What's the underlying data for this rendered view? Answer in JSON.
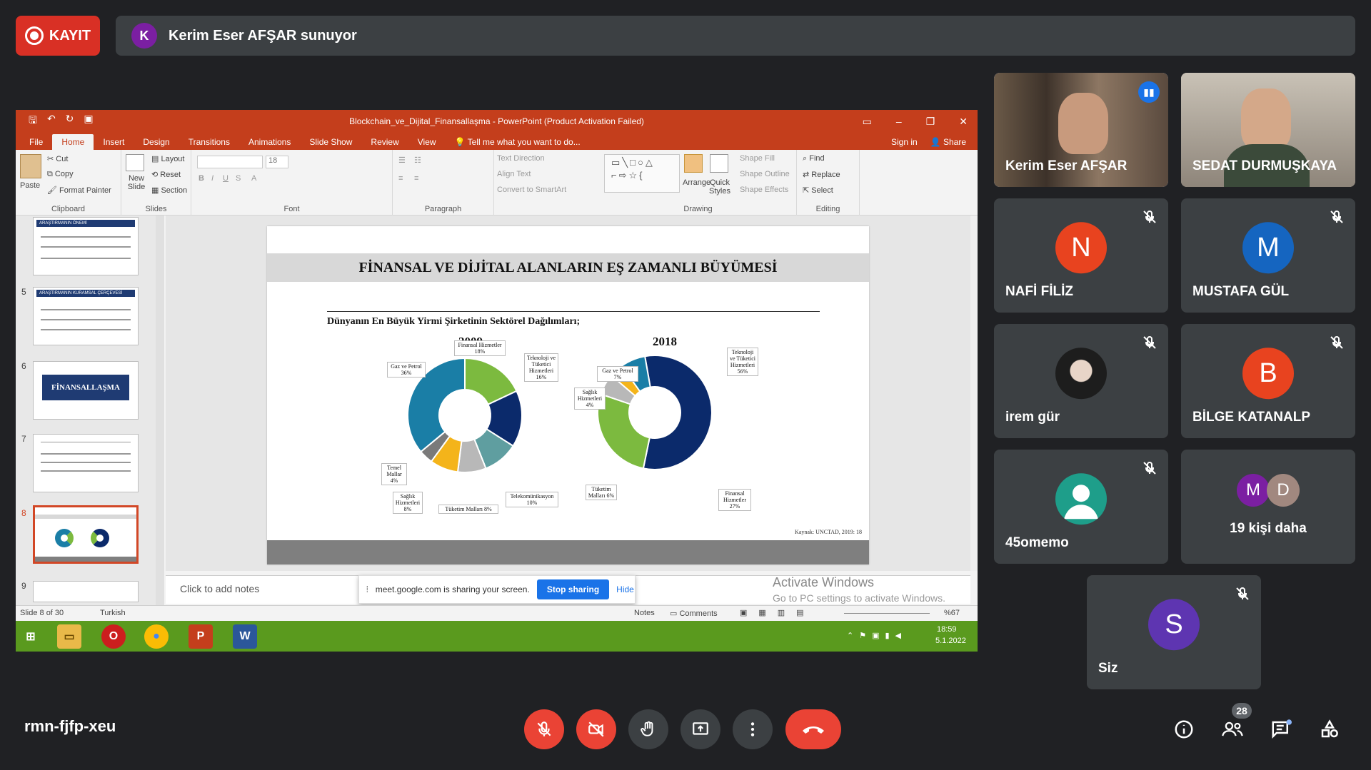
{
  "recording": {
    "label": "KAYIT"
  },
  "presenter": {
    "initial": "K",
    "text": "Kerim Eser AFŞAR sunuyor"
  },
  "ppt": {
    "title": "Blockchain_ve_Dijital_Finansallaşma - PowerPoint (Product Activation Failed)",
    "tabs": [
      "File",
      "Home",
      "Insert",
      "Design",
      "Transitions",
      "Animations",
      "Slide Show",
      "Review",
      "View"
    ],
    "tellme": "Tell me what you want to do...",
    "signin": "Sign in",
    "share": "Share",
    "ribbon": {
      "clipboard": {
        "label": "Clipboard",
        "paste": "Paste",
        "cut": "Cut",
        "copy": "Copy",
        "format_painter": "Format Painter"
      },
      "slides": {
        "label": "Slides",
        "new_slide": "New Slide",
        "layout": "Layout",
        "reset": "Reset",
        "section": "Section"
      },
      "font": {
        "label": "Font",
        "size": "18"
      },
      "paragraph": {
        "label": "Paragraph",
        "text_direction": "Text Direction",
        "align_text": "Align Text",
        "convert": "Convert to SmartArt"
      },
      "drawing": {
        "label": "Drawing",
        "arrange": "Arrange",
        "quick_styles": "Quick Styles",
        "shape_fill": "Shape Fill",
        "shape_outline": "Shape Outline",
        "shape_effects": "Shape Effects"
      },
      "editing": {
        "label": "Editing",
        "find": "Find",
        "replace": "Replace",
        "select": "Select"
      }
    },
    "thumbnails": [
      {
        "num": "",
        "title": "ARAŞTIRMANIN ÖNEMİ"
      },
      {
        "num": "5",
        "title": "ARAŞTIRMANIN KURAMSAL ÇERÇEVESİ"
      },
      {
        "num": "6",
        "title": "FİNANSALLAŞMA"
      },
      {
        "num": "7",
        "title": ""
      },
      {
        "num": "8",
        "title": ""
      },
      {
        "num": "9",
        "title": ""
      }
    ],
    "notes_placeholder": "Click to add notes",
    "status": {
      "slide": "Slide 8 of 30",
      "language": "Turkish",
      "notes": "Notes",
      "comments": "Comments",
      "zoom": "%67"
    },
    "taskbar": {
      "time": "18:59",
      "date": "5.1.2022"
    }
  },
  "slide": {
    "title": "FİNANSAL VE DİJİTAL ALANLARIN EŞ ZAMANLI BÜYÜMESİ",
    "subtitle": "Dünyanın En Büyük Yirmi Şirketinin Sektörel Dağılımları;",
    "source": "Kaynak: UNCTAD, 2019: 18"
  },
  "chart_data": [
    {
      "type": "pie",
      "title": "2009",
      "categories": [
        "Finansal Hizmetler",
        "Teknoloji ve Tüketici Hizmetleri",
        "Telekomünikasyon",
        "Tüketim Malları",
        "Sağlık Hizmetleri",
        "Temel Mallar",
        "Gaz ve Petrol"
      ],
      "labels": [
        "Finansal Hizmetler 18%",
        "Teknoloji ve Tüketici Hizmetleri 16%",
        "Telekomünikasyon 10%",
        "Tüketim Malları 8%",
        "Sağlık Hizmetleri 8%",
        "Temel Mallar 4%",
        "Gaz ve Petrol 36%"
      ],
      "values": [
        18,
        16,
        10,
        8,
        8,
        4,
        36
      ],
      "colors": [
        "#7cba3f",
        "#0b2a6b",
        "#5f9ea0",
        "#b8b8b8",
        "#f4b41a",
        "#7a7a7a",
        "#1a7ea6"
      ]
    },
    {
      "type": "pie",
      "title": "2018",
      "categories": [
        "Teknoloji ve Tüketici Hizmetleri",
        "Finansal Hizmetler",
        "Tüketim Malları",
        "Sağlık Hizmetleri",
        "Gaz ve Petrol"
      ],
      "labels": [
        "Teknoloji ve Tüketici Hizmetleri 56%",
        "Finansal Hizmetler 27%",
        "Tüketim Malları 6%",
        "Sağlık Hizmetleri 4%",
        "Gaz ve Petrol 7%"
      ],
      "values": [
        56,
        27,
        6,
        4,
        7
      ],
      "colors": [
        "#0b2a6b",
        "#7cba3f",
        "#b8b8b8",
        "#f4b41a",
        "#1a7ea6"
      ]
    }
  ],
  "sharebar": {
    "text": "meet.google.com is sharing your screen.",
    "stop": "Stop sharing",
    "hide": "Hide"
  },
  "activate": {
    "line1": "Activate Windows",
    "line2": "Go to PC settings to activate Windows."
  },
  "participants": [
    {
      "name": "Kerim Eser AFŞAR",
      "video": true,
      "speaking": true
    },
    {
      "name": "SEDAT DURMUŞKAYA",
      "video": true
    },
    {
      "name": "NAFİ FİLİZ",
      "initial": "N",
      "color": "#e8431f",
      "muted": true
    },
    {
      "name": "MUSTAFA GÜL",
      "initial": "M",
      "color": "#1565c0",
      "muted": true
    },
    {
      "name": "irem gür",
      "photo": true,
      "muted": true
    },
    {
      "name": "BİLGE KATANALP",
      "initial": "B",
      "color": "#e8431f",
      "muted": true
    },
    {
      "name": "45omemo",
      "generic": true,
      "color": "#1e9e8a",
      "muted": true
    },
    {
      "name": "19 kişi daha",
      "more": [
        "M",
        "D"
      ],
      "more_colors": [
        "#7b1fa2",
        "#a1887f"
      ]
    },
    {
      "name": "Siz",
      "initial": "S",
      "color": "#5e35b1",
      "muted": true
    }
  ],
  "meeting": {
    "code": "rmn-fjfp-xeu",
    "people_count": "28"
  },
  "colors": {
    "accent": "#8ab4f8",
    "danger": "#ea4335",
    "ppt": "#c43e1c"
  }
}
